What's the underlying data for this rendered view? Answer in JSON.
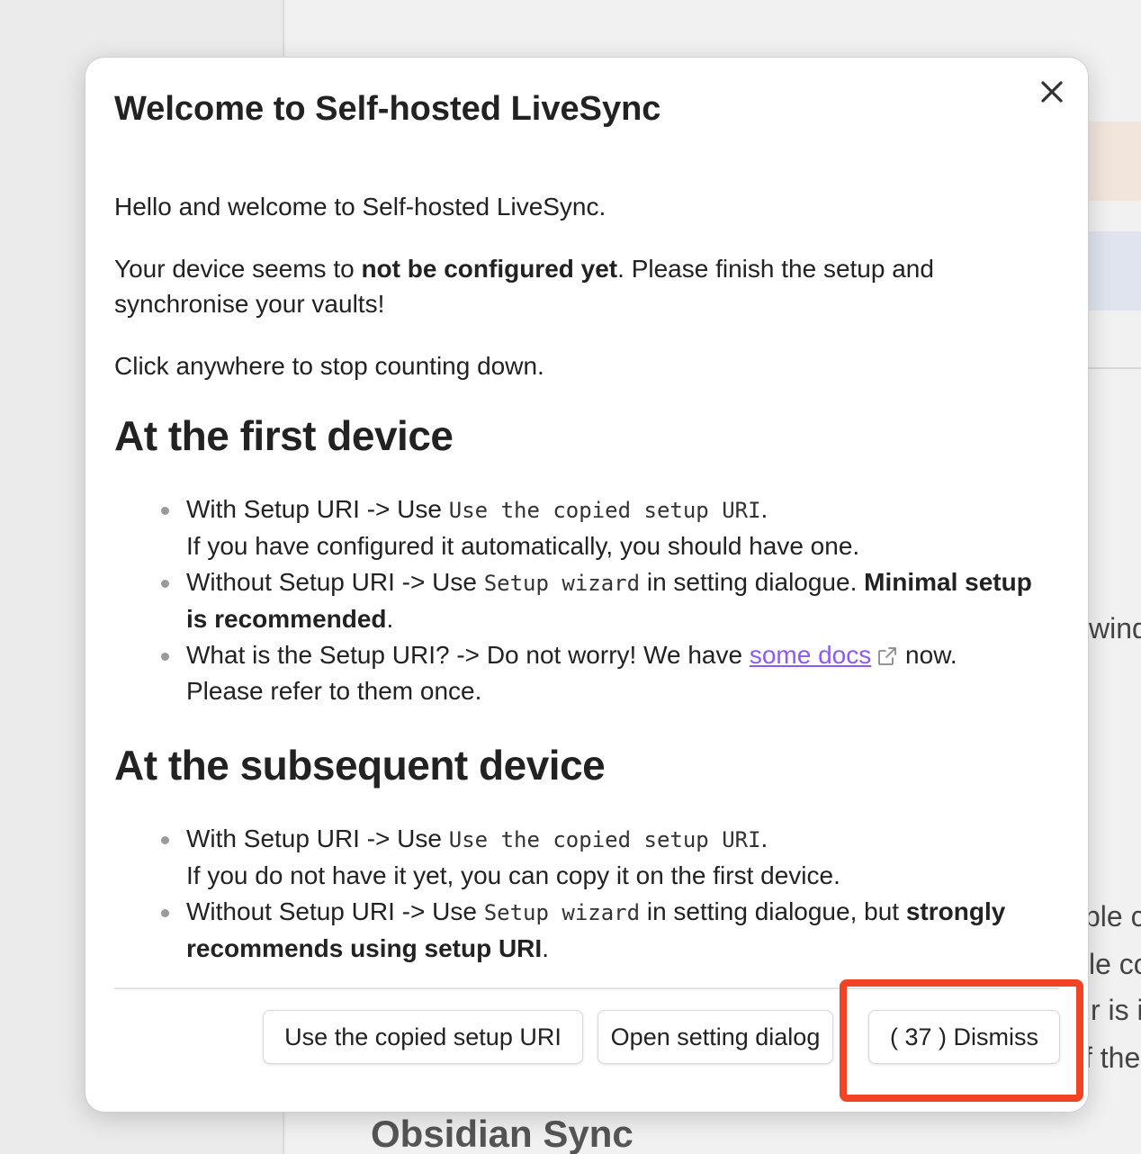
{
  "background": {
    "side_text": [
      "wind",
      "ble c",
      "le cc",
      "r is i",
      "f the"
    ],
    "section_heading": "Obsidian Sync"
  },
  "modal": {
    "title": "Welcome to Self-hosted LiveSync",
    "close_icon": "close-icon",
    "intro": "Hello and welcome to Self-hosted LiveSync.",
    "device_status": {
      "before": "Your device seems to ",
      "bold": "not be configured yet",
      "after": ". Please finish the setup and synchronise your vaults!"
    },
    "countdown_hint": "Click anywhere to stop counting down.",
    "first_device": {
      "heading": "At the first device",
      "item1": {
        "prefix": "With Setup URI -> Use ",
        "code": "Use the copied setup URI",
        "suffix": ".",
        "line2": "If you have configured it automatically, you should have one."
      },
      "item2": {
        "prefix": "Without Setup URI -> Use ",
        "code": "Setup wizard",
        "mid": " in setting dialogue. ",
        "bold": "Minimal setup is recommended",
        "suffix": "."
      },
      "item3": {
        "prefix": "What is the Setup URI? -> Do not worry! We have ",
        "link": "some docs",
        "suffix": " now.",
        "line2": "Please refer to them once."
      }
    },
    "subsequent_device": {
      "heading": "At the subsequent device",
      "item1": {
        "prefix": "With Setup URI -> Use ",
        "code": "Use the copied setup URI",
        "suffix": ".",
        "line2": "If you do not have it yet, you can copy it on the first device."
      },
      "item2": {
        "prefix": "Without Setup URI -> Use ",
        "code": "Setup wizard",
        "mid": " in setting dialogue, but ",
        "bold": "strongly recommends using setup URI",
        "suffix": "."
      }
    },
    "buttons": {
      "use_uri": "Use the copied setup URI",
      "open_settings": "Open setting dialog",
      "dismiss": "( 37 ) Dismiss"
    },
    "countdown_seconds": 37
  },
  "colors": {
    "link": "#8a5cf5",
    "highlight": "#f04424"
  }
}
